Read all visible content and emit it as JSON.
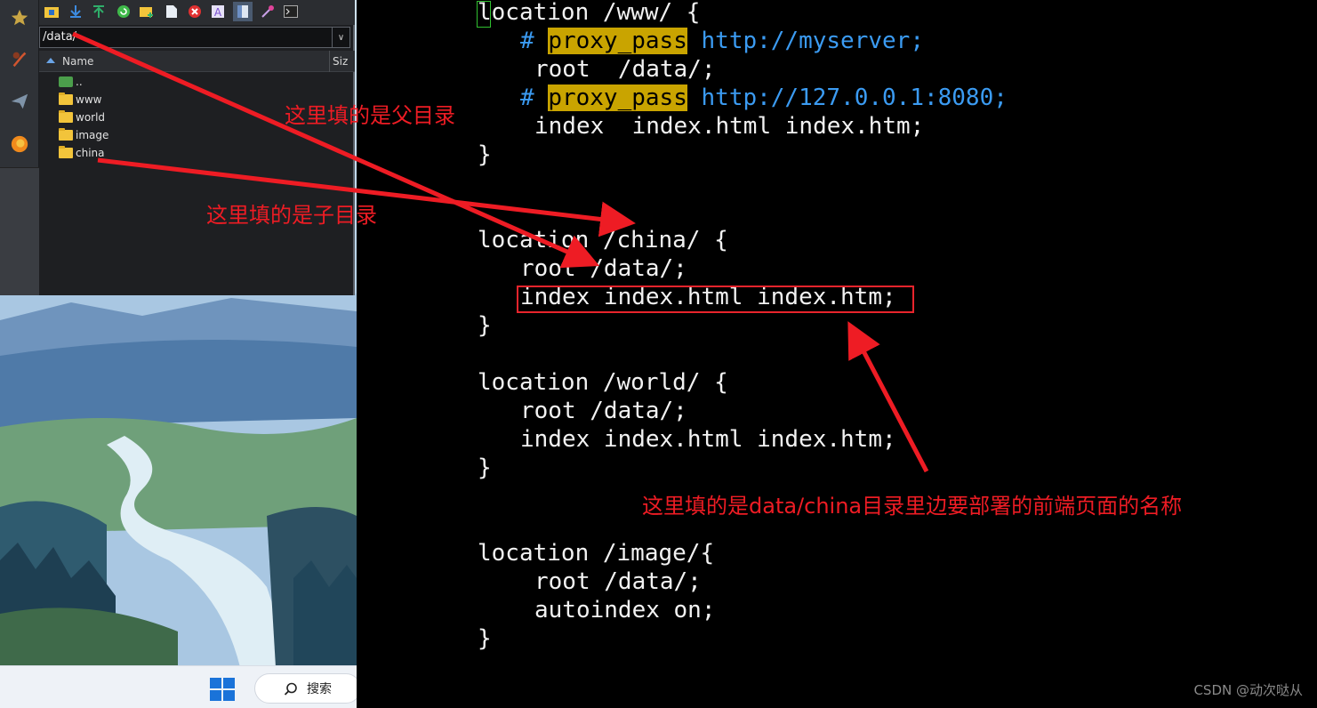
{
  "file_manager": {
    "path": "/data/",
    "columns": {
      "name": "Name",
      "size": "Siz"
    },
    "rows": [
      {
        "label": "..",
        "type": "up"
      },
      {
        "label": "www",
        "type": "folder"
      },
      {
        "label": "world",
        "type": "folder"
      },
      {
        "label": "image",
        "type": "folder"
      },
      {
        "label": "china",
        "type": "folder"
      }
    ],
    "toolbar_icons": [
      "new-folder-icon",
      "download-icon",
      "upload-icon",
      "refresh-icon",
      "add-folder-icon",
      "new-file-icon",
      "delete-icon",
      "rename-icon",
      "view-icon",
      "magic-wand-icon",
      "terminal-icon"
    ]
  },
  "sidebar": {
    "icons": [
      "star-icon",
      "tool-icon",
      "send-icon",
      "firefox-icon"
    ]
  },
  "taskbar": {
    "search_label": "搜索"
  },
  "code": {
    "l1": "location /www/ {",
    "l2_hash": "#",
    "l2_kw": "proxy_pass",
    "l2_url": "http://myserver;",
    "l3": "root  /data/;",
    "l4_hash": "#",
    "l4_kw": "proxy_pass",
    "l4_url": "http://127.0.0.1:8080;",
    "l5": "index  index.html index.htm;",
    "l6": "}",
    "l7": "location /china/ {",
    "l8": "root /data/;",
    "l9": "index index.html index.htm;",
    "l10": "}",
    "l11": "location /world/ {",
    "l12": "root /data/;",
    "l13": "index index.html index.htm;",
    "l14": "}",
    "l15": "location /image/{",
    "l16": "root /data/;",
    "l17": "autoindex on;",
    "l18": "}"
  },
  "annotations": {
    "parent_dir": "这里填的是父目录",
    "child_dir": "这里填的是子目录",
    "page_name": "这里填的是data/china目录里边要部署的前端页面的名称"
  },
  "watermark": "CSDN @动次哒从",
  "colors": {
    "annotation": "#ee1c24",
    "comment": "#3b9bf2",
    "keyword_highlight": "#c9a400"
  }
}
